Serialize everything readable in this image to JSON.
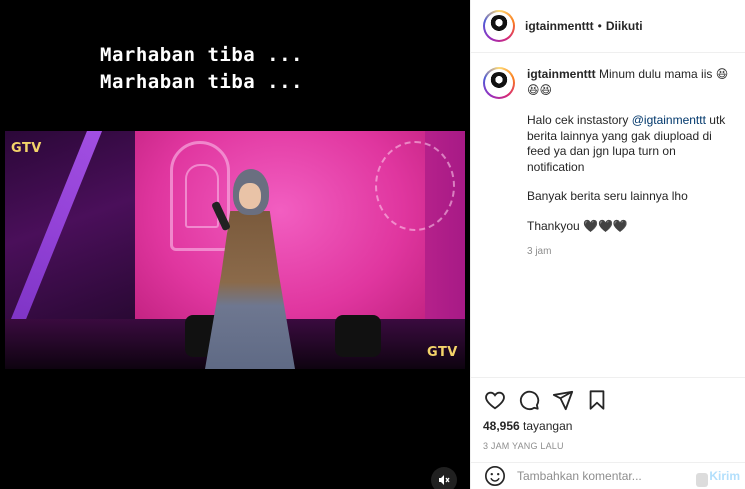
{
  "video": {
    "overlay_line1": "Marhaban tiba ...",
    "overlay_line2": "Marhaban tiba ...",
    "logo_top": "GTV",
    "logo_bottom": "GTV",
    "mute_icon": "speaker-muted-icon"
  },
  "header": {
    "username": "igtainmenttt",
    "separator": "•",
    "follow_status": "Diikuti"
  },
  "caption": {
    "username": "igtainmenttt",
    "first_line": "Minum dulu mama iis 😆😆😆",
    "para1_before": "Halo cek instastory ",
    "para1_mention": "@igtainmenttt",
    "para1_after": " utk berita lainnya yang gak diupload di feed ya dan jgn lupa turn on notification",
    "para2": "Banyak berita seru lainnya lho",
    "para3": "Thankyou 🖤🖤🖤",
    "time_ago": "3 jam"
  },
  "actions": {
    "icons": [
      "heart-icon",
      "comment-icon",
      "share-icon",
      "bookmark-icon"
    ],
    "views_count": "48,956",
    "views_label": "tayangan",
    "posted_time": "3 JAM YANG LALU"
  },
  "comment_box": {
    "placeholder": "Tambahkan komentar...",
    "post_label": "Kirim"
  }
}
